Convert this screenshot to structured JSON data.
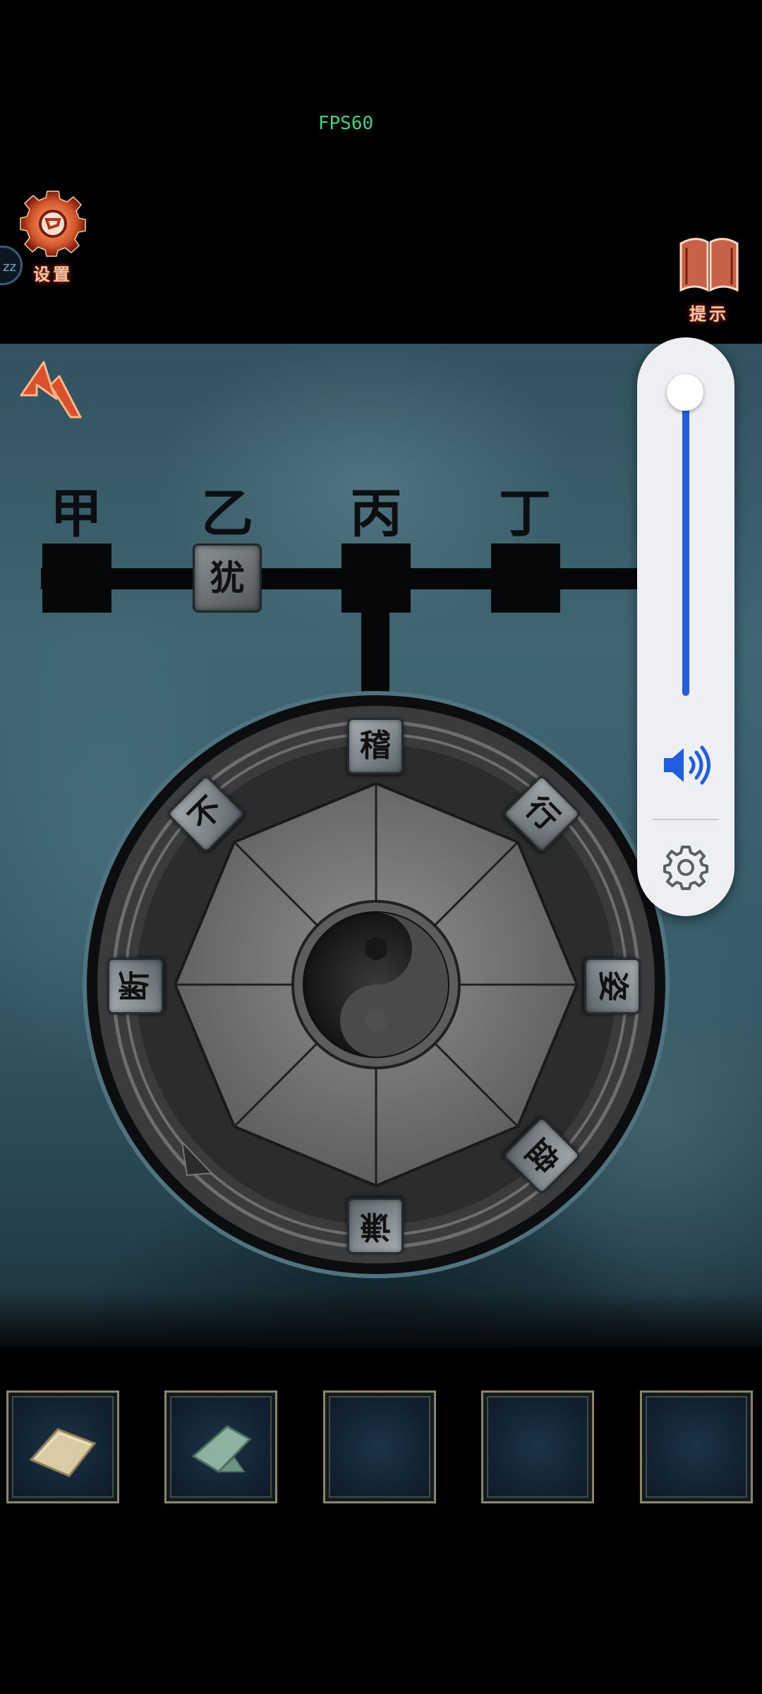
{
  "hud": {
    "fps_text": "FPS60",
    "settings_label": "设置",
    "hint_label": "提示",
    "sleep_badge": "zz"
  },
  "puzzle": {
    "column_labels": [
      "甲",
      "乙",
      "丙",
      "丁"
    ],
    "slots": [
      {
        "column": "甲",
        "tile": ""
      },
      {
        "column": "乙",
        "tile": "犹"
      },
      {
        "column": "丙",
        "tile": ""
      },
      {
        "column": "丁",
        "tile": ""
      }
    ],
    "wheel_tiles": [
      "稽",
      "行",
      "姿",
      "盘",
      "谦",
      "",
      "断",
      "不"
    ],
    "center_symbol": "yin-yang"
  },
  "volume_panel": {
    "level": 1.0,
    "speaker_icon": "speaker-icon",
    "settings_icon": "gear-icon",
    "accent_color": "#1f5ee0"
  },
  "inventory": {
    "slots": [
      {
        "item": "parchment-scroll-icon"
      },
      {
        "item": "folded-green-paper-icon"
      },
      {
        "item": ""
      },
      {
        "item": ""
      },
      {
        "item": ""
      }
    ]
  }
}
